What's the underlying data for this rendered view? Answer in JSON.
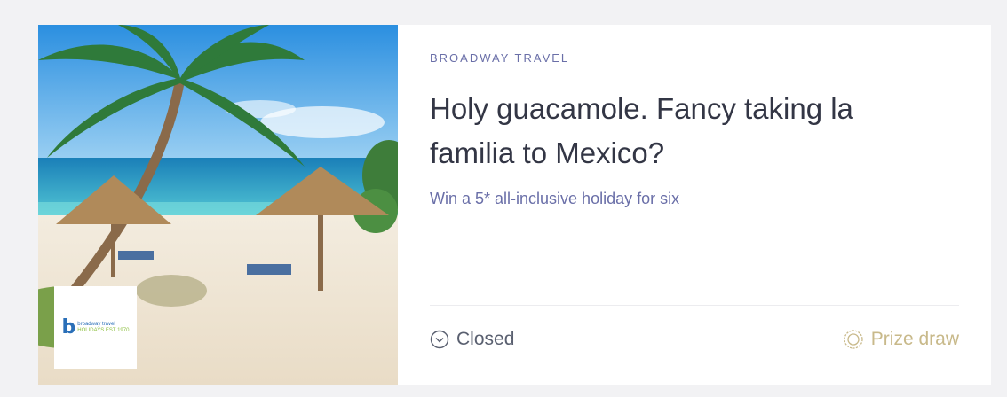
{
  "card": {
    "brand": "BROADWAY TRAVEL",
    "headline": "Holy guacamole. Fancy taking la familia to Mexico?",
    "subline": "Win a 5* all-inclusive holiday for six",
    "logo": {
      "mark": "b",
      "line1": "broadway travel",
      "line2": "HOLIDAYS EST 1970"
    },
    "status": {
      "icon": "chevron-down-circle-icon",
      "label": "Closed"
    },
    "prize": {
      "icon": "prize-badge-icon",
      "label": "Prize draw"
    }
  },
  "colors": {
    "brand": "#6a6fa8",
    "headline": "#333645",
    "status": "#5a6070",
    "prize": "#c8b98a"
  }
}
